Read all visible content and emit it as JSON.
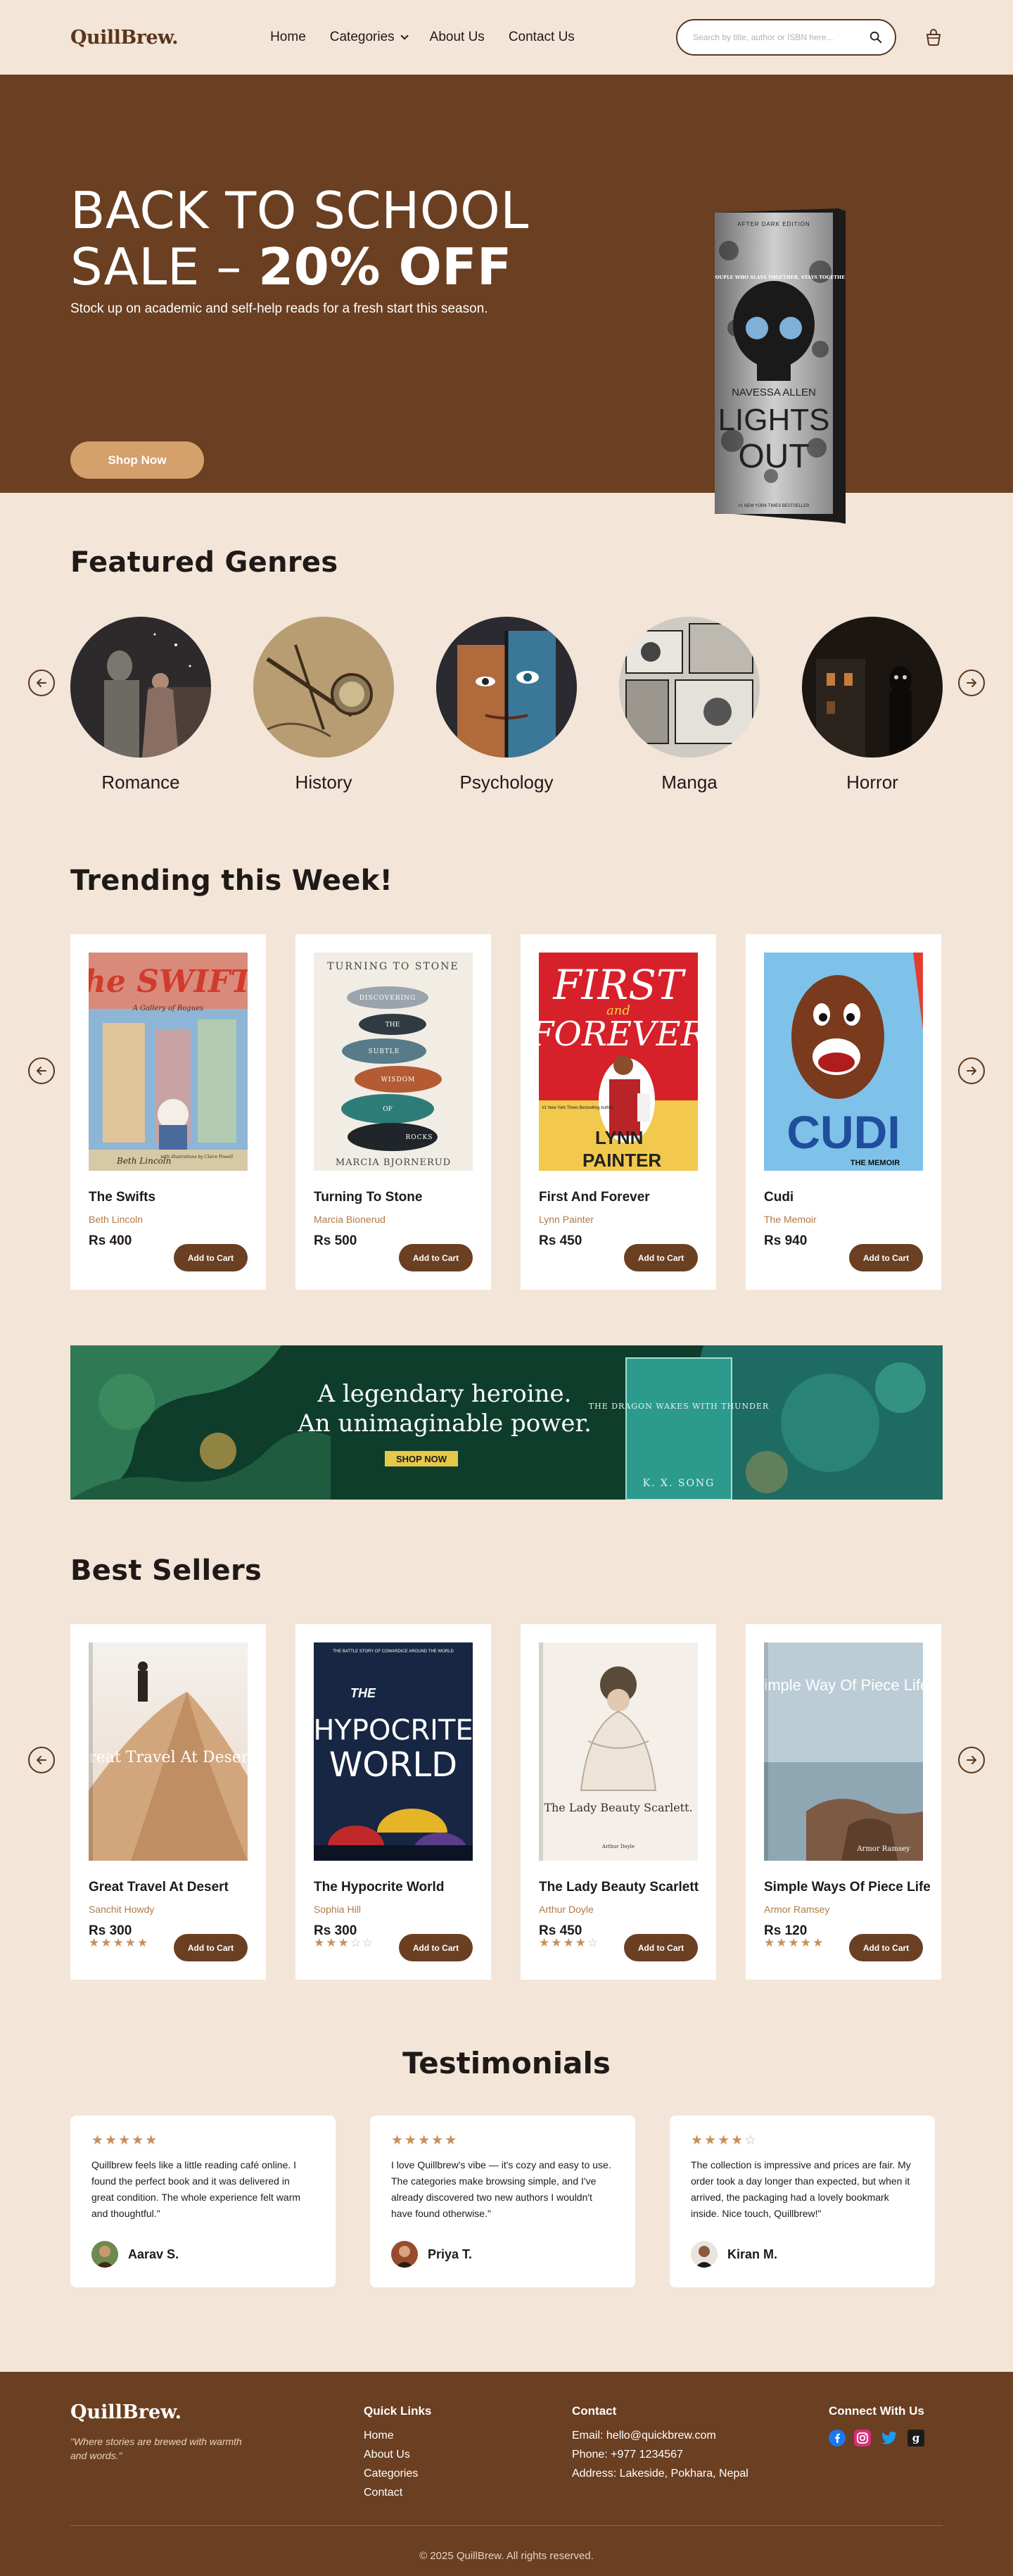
{
  "header": {
    "logo": "QuillBrew.",
    "nav": [
      "Home",
      "Categories",
      "About Us",
      "Contact Us"
    ],
    "search_placeholder": "Search by title, author or ISBN here..."
  },
  "hero": {
    "title_line1": "BACK TO SCHOOL",
    "title_line2_a": "SALE – ",
    "title_line2_b": "20% OFF",
    "subtitle": "Stock up on academic and self-help reads for a fresh start this season.",
    "cta": "Shop Now",
    "book": {
      "edition": "AFTER DARK EDITION",
      "tagline": "THE COUPLE WHO SLAYS TOGETHER, STAYS TOGETHER",
      "author": "NAVESSA ALLEN",
      "title1": "LIGHTS",
      "title2": "OUT",
      "footer": "#1 NEW YORK TIMES BESTSELLER"
    }
  },
  "genres": {
    "title": "Featured Genres",
    "items": [
      "Romance",
      "History",
      "Psychology",
      "Manga",
      "Horror"
    ]
  },
  "trending": {
    "title": "Trending this Week!",
    "add_label": "Add to Cart",
    "items": [
      {
        "title": "The Swifts",
        "author": "Beth Lincoln",
        "price": "Rs 400",
        "cover_title": "The SWIFTS",
        "cover_sub": "A Gallery of Rogues",
        "cover_author": "Beth Lincoln",
        "cover_illus": "with illustrations by Claire Powell"
      },
      {
        "title": "Turning To Stone",
        "author": "Marcia Bionerud",
        "price": "Rs 500",
        "cover_title": "TURNING TO STONE",
        "cover_words": [
          "DISCOVERING",
          "THE",
          "SUBTLE",
          "WISDOM",
          "OF",
          "ROCKS"
        ],
        "cover_author": "MARCIA BJORNERUD"
      },
      {
        "title": "First And Forever",
        "author": "Lynn Painter",
        "price": "Rs 450",
        "cover_title1": "FIRST",
        "cover_and": "and",
        "cover_title2": "FOREVER",
        "cover_badge": "#1 New York Times Bestselling Author",
        "cover_author1": "LYNN",
        "cover_author2": "PAINTER"
      },
      {
        "title": "Cudi",
        "author": "The Memoir",
        "price": "Rs 940",
        "cover_title": "CUDI",
        "cover_sub": "THE MEMOIR"
      }
    ]
  },
  "banner": {
    "line1": "A legendary heroine.",
    "line2": "An unimaginable power.",
    "cta": "SHOP NOW",
    "book_title": "THE DRAGON WAKES WITH THUNDER",
    "book_author": "K. X. SONG"
  },
  "bestsellers": {
    "title": "Best Sellers",
    "add_label": "Add to Cart",
    "items": [
      {
        "title": "Great Travel At Desert",
        "author": "Sanchit Howdy",
        "price": "Rs 300",
        "rating": 5,
        "cover_title": "Great Travel At Desert."
      },
      {
        "title": "The Hypocrite World",
        "author": "Sophia Hill",
        "price": "Rs 300",
        "rating": 3,
        "cover_top": "THE BATTLE STORY OF COWARDICE AROUND THE WORLD",
        "cover_the": "THE",
        "cover_title1": "HYPOCRITE",
        "cover_title2": "WORLD"
      },
      {
        "title": "The Lady Beauty Scarlett",
        "author": "Arthur Doyle",
        "price": "Rs 450",
        "rating": 4,
        "cover_title": "The Lady Beauty Scarlett.",
        "cover_author": "Arthur Doyle"
      },
      {
        "title": "Simple Ways Of Piece Life",
        "author": "Armor Ramsey",
        "price": "Rs 120",
        "rating": 5,
        "cover_title": "Simple Way Of Piece Life.",
        "cover_author": "Armor Ramsey"
      }
    ]
  },
  "testimonials": {
    "title": "Testimonials",
    "items": [
      {
        "rating": 5,
        "text": "Quillbrew feels like a little reading café online. I found the perfect book and it was delivered in great condition. The whole experience felt warm and thoughtful.\"",
        "name": "Aarav S."
      },
      {
        "rating": 5,
        "text": "I love Quillbrew's vibe — it's cozy and easy to use. The categories make browsing simple, and I've already discovered two new authors I wouldn't have found otherwise.\"",
        "name": "Priya T."
      },
      {
        "rating": 4,
        "text": "The collection is impressive and prices are fair. My order took a day longer than expected, but when it arrived, the packaging had a lovely bookmark inside. Nice touch, Quillbrew!\"",
        "name": "Kiran M."
      }
    ]
  },
  "footer": {
    "logo": "QuillBrew.",
    "tagline": "\"Where stories are brewed with warmth and words.\"",
    "quick_links_title": "Quick Links",
    "quick_links": [
      "Home",
      "About Us",
      "Categories",
      "Contact"
    ],
    "contact_title": "Contact",
    "contact": [
      "Email: hello@quickbrew.com",
      "Phone: +977 1234567",
      "Address: Lakeside, Pokhara, Nepal"
    ],
    "connect_title": "Connect With Us",
    "social_icons": [
      "facebook-icon",
      "instagram-icon",
      "twitter-icon",
      "goodreads-icon"
    ],
    "copyright": "© 2025 QuillBrew. All rights reserved."
  },
  "colors": {
    "background": "#f3e5d8",
    "brand_brown": "#6b3f22",
    "accent_tan": "#d4a06c",
    "star": "#c98f5a"
  }
}
